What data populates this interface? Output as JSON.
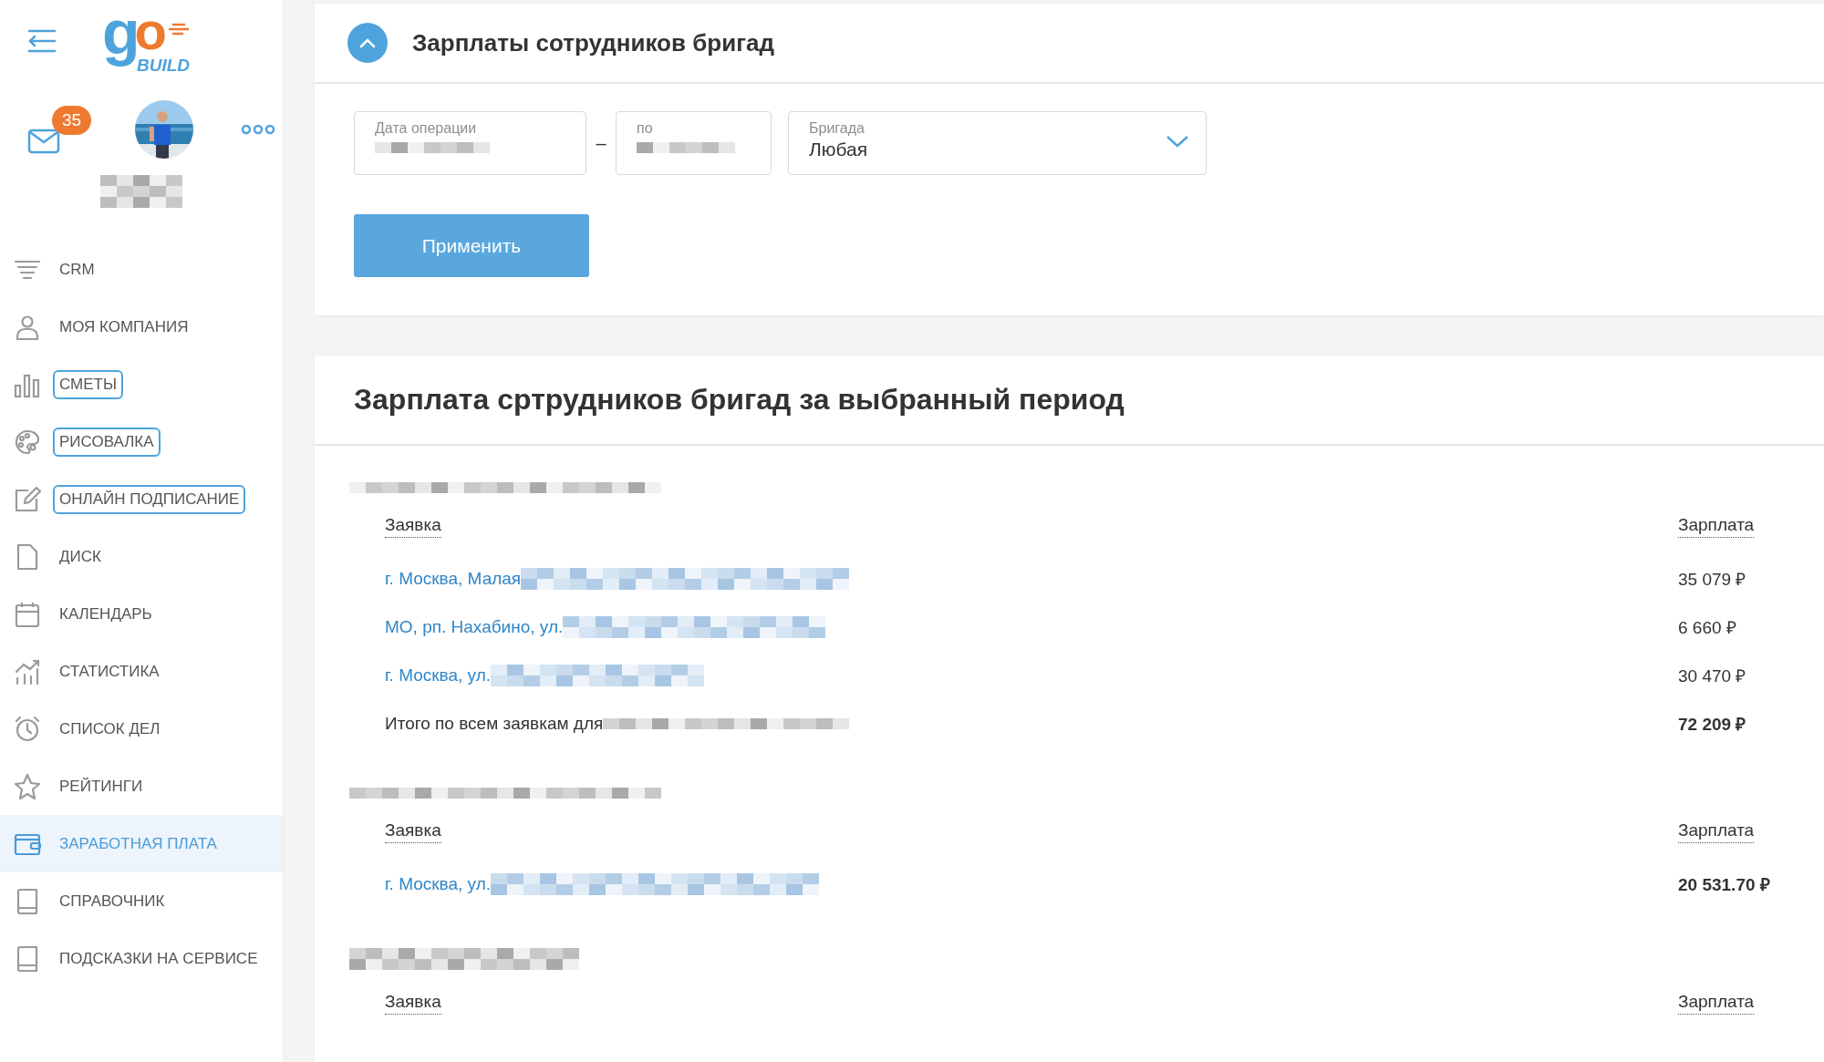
{
  "sidebar": {
    "logo": {
      "first": "g",
      "second": "o",
      "word": "BUILD"
    },
    "mail_badge": "35",
    "items": [
      {
        "label": "CRM",
        "outlined": false,
        "selected": false
      },
      {
        "label": "МОЯ КОМПАНИЯ",
        "outlined": false,
        "selected": false
      },
      {
        "label": "СМЕТЫ",
        "outlined": true,
        "selected": false
      },
      {
        "label": "РИСОВАЛКА",
        "outlined": true,
        "selected": false
      },
      {
        "label": "ОНЛАЙН ПОДПИСАНИЕ",
        "outlined": true,
        "selected": false
      },
      {
        "label": "ДИСК",
        "outlined": false,
        "selected": false
      },
      {
        "label": "КАЛЕНДАРЬ",
        "outlined": false,
        "selected": false
      },
      {
        "label": "СТАТИСТИКА",
        "outlined": false,
        "selected": false
      },
      {
        "label": "СПИСОК ДЕЛ",
        "outlined": false,
        "selected": false
      },
      {
        "label": "РЕЙТИНГИ",
        "outlined": false,
        "selected": false
      },
      {
        "label": "ЗАРАБОТНАЯ ПЛАТА",
        "outlined": false,
        "selected": true
      },
      {
        "label": "СПРАВОЧНИК",
        "outlined": false,
        "selected": false
      },
      {
        "label": "ПОДСКАЗКИ НА СЕРВИСЕ",
        "outlined": false,
        "selected": false
      }
    ]
  },
  "filter_card": {
    "title": "Зарплаты сотрудников бригад",
    "expanded": true,
    "fields": [
      {
        "kind": "date",
        "label": "Дата операции"
      },
      {
        "kind": "date",
        "label": "по"
      },
      {
        "kind": "select",
        "label": "Бригада",
        "value": "Любая"
      }
    ],
    "separator": "–",
    "apply_button": "Применить"
  },
  "results": {
    "title": "Зарплата сртрудников бригад за выбранный период",
    "sections": [
      {
        "columns": [
          "Заявка",
          "Зарплата"
        ],
        "rows": [
          {
            "kind": "order",
            "text": "г. Москва, Малая",
            "amount": "35 079 ₽",
            "emphasized": false
          },
          {
            "kind": "order",
            "text": "МО, рп. Нахабино, ул.",
            "amount": "6 660 ₽",
            "emphasized": false
          },
          {
            "kind": "order",
            "text": "г. Москва, ул.",
            "amount": "30 470 ₽",
            "emphasized": false
          },
          {
            "kind": "total",
            "text": "Итого по всем заявкам для",
            "amount": "72 209 ₽",
            "emphasized": true
          }
        ]
      },
      {
        "columns": [
          "Заявка",
          "Зарплата"
        ],
        "rows": [
          {
            "kind": "order",
            "text": "г. Москва, ул.",
            "amount": "20 531.70 ₽",
            "emphasized": true
          }
        ]
      },
      {
        "columns": [
          "Заявка",
          "Зарплата"
        ]
      }
    ]
  }
}
